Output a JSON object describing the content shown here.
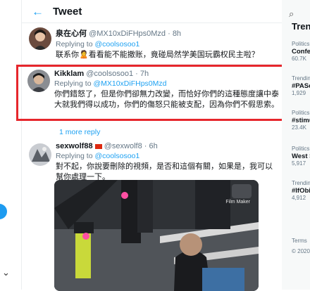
{
  "header": {
    "title": "Tweet"
  },
  "tweets": [
    {
      "name": "泉在心何",
      "handle": "@MX10xDiFHps0Mzd",
      "time": "· 8h",
      "replying_label": "Replying to",
      "replying_to": "@coolsosoo1",
      "text": "联系你🙎看看能不能撤账，竟碰局然学美国玩霸权民主啦？"
    },
    {
      "name": "Kikklam",
      "handle": "@coolsosoo1",
      "time": "· 7h",
      "replying_label": "Replying to",
      "replying_to": "@MX10xDiFHps0Mzd",
      "text": "你們錯怒了，但是你們卻無力改變，而恰好你們的這種態度讓中泰大就我們得以成功，你們的傷怒只能被支配，因為你們不假思索。"
    },
    {
      "name": "sexwolf88",
      "handle": "@sexwolf8",
      "time": "· 6h",
      "replying_label": "Replying to",
      "replying_to": "@coolsosoo1",
      "text": "對不起，你說要刪除的視頻，是否和這個有關，如果是，我可以幫你處理一下。"
    }
  ],
  "more_replies": "1 more reply",
  "media": {
    "watermark": "Film Maker"
  },
  "sidebar": {
    "heading": "Tren",
    "trends": [
      {
        "category": "Politics",
        "title": "Confe",
        "count": "60.7K"
      },
      {
        "category": "Trendin",
        "title": "#PASc",
        "count": "1,929"
      },
      {
        "category": "Politics",
        "title": "#stimu",
        "count": "23.4K"
      },
      {
        "category": "Politics",
        "title": "West S",
        "count": "5,917"
      },
      {
        "category": "Trendin",
        "title": "#IfObi",
        "count": "4,912"
      }
    ],
    "footer_terms": "Terms",
    "footer_copy": "© 2020"
  }
}
